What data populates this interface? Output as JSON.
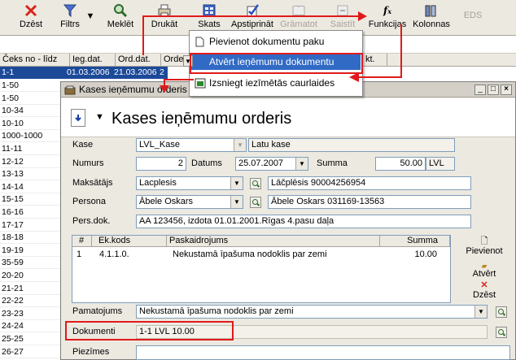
{
  "toolbar": {
    "buttons": [
      {
        "label": "Dzēst",
        "icon": "delete-x-icon",
        "enabled": true
      },
      {
        "label": "Filtrs",
        "icon": "filter-funnel-icon",
        "enabled": true
      },
      {
        "label": "Meklēt",
        "icon": "search-magnifier-icon",
        "enabled": true
      },
      {
        "label": "Drukāt",
        "icon": "printer-icon",
        "enabled": true
      },
      {
        "label": "Skats",
        "icon": "view-icon",
        "enabled": true
      },
      {
        "label": "Apstiprināt",
        "icon": "approve-icon",
        "enabled": true
      },
      {
        "label": "Grāmatot",
        "icon": "book-icon",
        "enabled": false
      },
      {
        "label": "Saistīt",
        "icon": "link-icon",
        "enabled": false
      },
      {
        "label": "Funkcijas",
        "icon": "functions-fx-icon",
        "enabled": true
      },
      {
        "label": "Kolonnas",
        "icon": "columns-icon",
        "enabled": true
      },
      {
        "label": "EDS",
        "icon": "",
        "enabled": false
      }
    ]
  },
  "grid": {
    "columns": [
      "Čeks no - līdz",
      "Ieg.dat.",
      "Ord.dat.",
      "Order",
      "kt."
    ],
    "selected_row": {
      "cheks": "1-1",
      "ieg": "01.03.2006",
      "ord": "21.03.2006",
      "order": "2"
    },
    "rows": [
      "1-50",
      "1-50",
      "10-34",
      "10-10",
      "1000-1000",
      "11-11",
      "12-12",
      "13-13",
      "14-14",
      "15-15",
      "16-16",
      "17-17",
      "18-18",
      "19-19",
      "35-59",
      "20-20",
      "21-21",
      "22-22",
      "23-23",
      "24-24",
      "25-25",
      "26-27"
    ]
  },
  "menu": {
    "items": [
      {
        "label": "Pievienot dokumentu paku",
        "icon": "document-icon",
        "selected": false
      },
      {
        "label": "Atvērt ieņēmumu dokumentu",
        "icon": "open-doc-icon",
        "selected": true
      },
      {
        "label": "Izsniegt iezīmētās caurlaides",
        "icon": "issue-passes-icon",
        "selected": false
      }
    ]
  },
  "dialog": {
    "window_title": "Kases ieņēmumu orderis",
    "heading": "Kases ieņēmumu orderis",
    "labels": {
      "kase": "Kase",
      "numurs": "Numurs",
      "datums": "Datums",
      "summa": "Summa",
      "maksatajs": "Maksātājs",
      "persona": "Persona",
      "persdok": "Pers.dok.",
      "pamatojums": "Pamatojums",
      "dokumenti": "Dokumenti",
      "piezimes": "Piezīmes"
    },
    "fields": {
      "kase": "LVL_Kase",
      "kase_desc": "Latu kase",
      "numurs": "2",
      "datums": "25.07.2007",
      "summa": "50.00",
      "valuta": "LVL",
      "maksatajs": "Lacplesis",
      "maksatajs_desc": "Lāčplēsis 90004256954",
      "persona": "Ābele Oskars",
      "persona_desc": "Ābele Oskars 031169-13563",
      "persdok": "AA 123456, izdota 01.01.2001.Rīgas 4.pasu daļa",
      "pamatojums": "Nekustamā īpašuma nodoklis par zemi",
      "dokumenti": "1-1 LVL 10.00",
      "piezimes": ""
    },
    "table": {
      "columns": [
        "#",
        "Ek.kods",
        "Paskaidrojums",
        "Summa"
      ],
      "rows": [
        {
          "n": "1",
          "ek": "4.1.1.0.",
          "desc": "Nekustamā īpašuma nodoklis par zemi",
          "summa": "10.00"
        }
      ]
    },
    "side_buttons": [
      "Pievienot",
      "Atvērt",
      "Dzēst"
    ]
  },
  "colors": {
    "selection": "#1c4a99",
    "menu_highlight": "#316ac5",
    "annotation": "#e01a1a"
  }
}
